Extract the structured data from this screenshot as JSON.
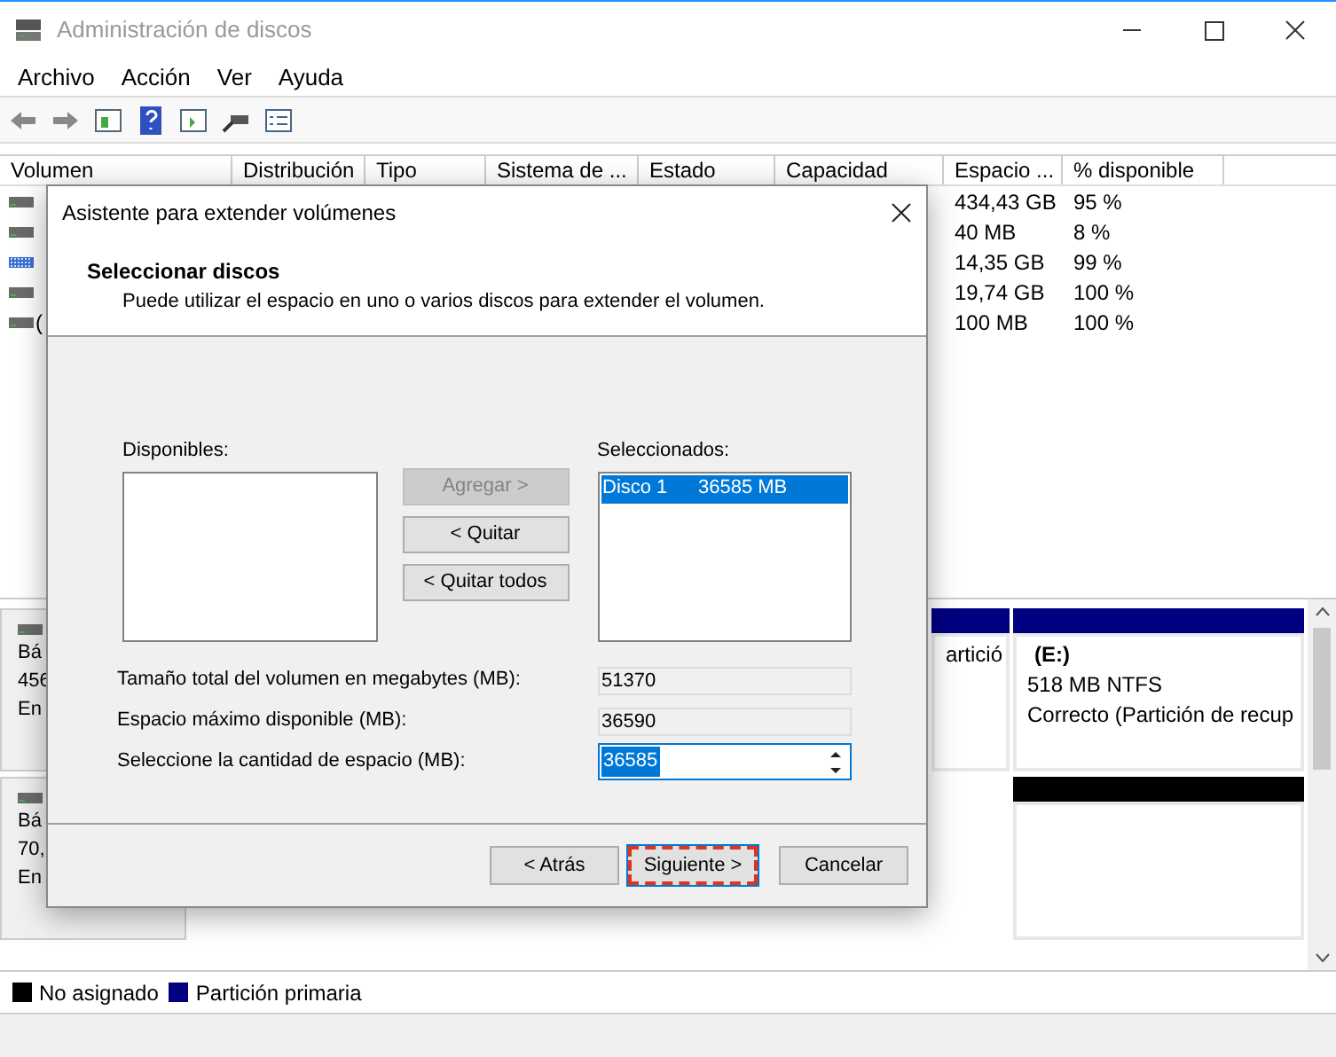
{
  "window": {
    "title": "Administración de discos"
  },
  "menu": [
    "Archivo",
    "Acción",
    "Ver",
    "Ayuda"
  ],
  "table": {
    "columns": [
      "Volumen",
      "Distribución",
      "Tipo",
      "Sistema de ...",
      "Estado",
      "Capacidad",
      "Espacio ...",
      "% disponible"
    ],
    "rows": [
      {
        "kind": "disk",
        "free": "434,43 GB",
        "percent": "95 %"
      },
      {
        "kind": "disk",
        "free": "40 MB",
        "percent": "8 %"
      },
      {
        "kind": "striped",
        "free": "14,35 GB",
        "percent": "99 %"
      },
      {
        "kind": "disk",
        "free": "19,74 GB",
        "percent": "100 %"
      },
      {
        "kind": "disk",
        "volume": "(",
        "free": "100 MB",
        "percent": "100 %"
      }
    ]
  },
  "disks": [
    {
      "lines": [
        "Bá",
        "456",
        "En"
      ],
      "partitions": [
        {
          "kind": "primary",
          "lines": [
            "artició"
          ]
        },
        {
          "kind": "primary",
          "lines": [
            "(E:)",
            "518 MB NTFS",
            "Correcto (Partición de recup"
          ]
        }
      ]
    },
    {
      "lines": [
        "Bá",
        "70,",
        "En"
      ],
      "partitions": [
        {
          "kind": "unallocated"
        }
      ]
    }
  ],
  "legend": [
    {
      "label": "No asignado",
      "color": "#000000"
    },
    {
      "label": "Partición primaria",
      "color": "#000080"
    }
  ],
  "dialog": {
    "title": "Asistente para extender volúmenes",
    "heading": "Seleccionar discos",
    "subtitle": "Puede utilizar el espacio en uno o varios discos para extender el volumen.",
    "available_label": "Disponibles:",
    "selected_label": "Seleccionados:",
    "selected_items": [
      {
        "disk": "Disco 1",
        "size": "36585 MB",
        "selected": true
      }
    ],
    "move_buttons": [
      {
        "label": "Agregar >",
        "disabled": true
      },
      {
        "label": "< Quitar",
        "disabled": false
      },
      {
        "label": "< Quitar todos",
        "disabled": false
      }
    ],
    "fields": [
      {
        "label": "Tamaño total del volumen en megabytes (MB):",
        "value": "51370",
        "kind": "readonly"
      },
      {
        "label": "Espacio máximo disponible (MB):",
        "value": "36590",
        "kind": "readonly"
      },
      {
        "label": "Seleccione la cantidad de espacio (MB):",
        "value": "36585",
        "kind": "spin"
      }
    ],
    "buttons": [
      {
        "label": "< Atrás",
        "focused": false
      },
      {
        "label": "Siguiente >",
        "focused": true
      },
      {
        "label": "Cancelar",
        "focused": false
      }
    ]
  }
}
